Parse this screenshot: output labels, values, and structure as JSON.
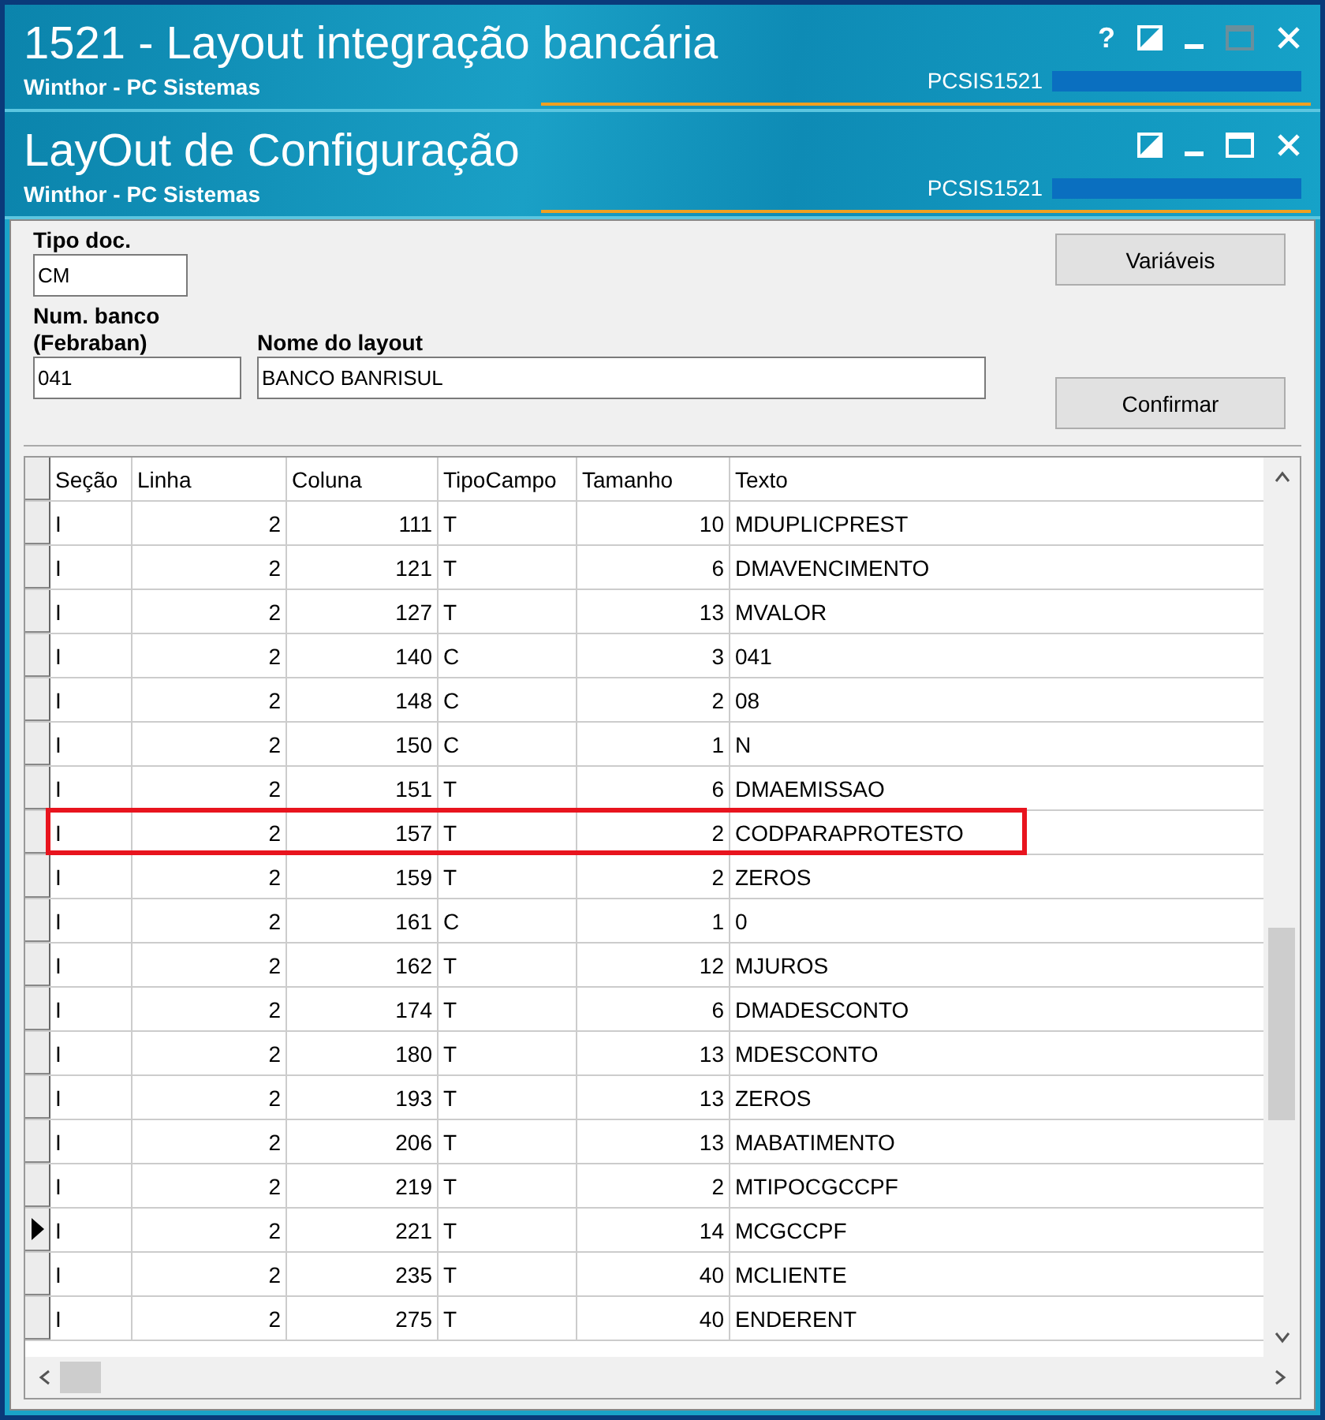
{
  "windows": [
    {
      "title": "1521 - Layout integração bancária",
      "subtitle": "Winthor - PC Sistemas",
      "code": "PCSIS1521",
      "controls": [
        {
          "kind": "help",
          "label": "?"
        },
        {
          "kind": "restore"
        },
        {
          "kind": "minimize"
        },
        {
          "kind": "maximize",
          "disabled": true
        },
        {
          "kind": "close"
        }
      ]
    },
    {
      "title": "LayOut de Configuração",
      "subtitle": "Winthor - PC Sistemas",
      "code": "PCSIS1521",
      "controls": [
        {
          "kind": "restore"
        },
        {
          "kind": "minimize"
        },
        {
          "kind": "maximize",
          "disabled": false
        },
        {
          "kind": "close"
        }
      ]
    }
  ],
  "form": {
    "tipo_doc": {
      "label": "Tipo doc.",
      "value": "CM"
    },
    "num_banco": {
      "label": "Num. banco\n(Febraban)",
      "value": "041"
    },
    "nome_layout": {
      "label": "Nome do layout",
      "value": "BANCO BANRISUL"
    },
    "buttons": [
      "Variáveis",
      "Confirmar"
    ]
  },
  "table": {
    "columns": [
      "Seção",
      "Linha",
      "Coluna",
      "TipoCampo",
      "Tamanho",
      "Texto"
    ],
    "rows": [
      {
        "cells": [
          "I",
          "2",
          "111",
          "T",
          "10",
          "MDUPLICPREST"
        ],
        "current": false,
        "highlighted": false
      },
      {
        "cells": [
          "I",
          "2",
          "121",
          "T",
          "6",
          "DMAVENCIMENTO"
        ],
        "current": false,
        "highlighted": false
      },
      {
        "cells": [
          "I",
          "2",
          "127",
          "T",
          "13",
          "MVALOR"
        ],
        "current": false,
        "highlighted": false
      },
      {
        "cells": [
          "I",
          "2",
          "140",
          "C",
          "3",
          "041"
        ],
        "current": false,
        "highlighted": false
      },
      {
        "cells": [
          "I",
          "2",
          "148",
          "C",
          "2",
          "08"
        ],
        "current": false,
        "highlighted": false
      },
      {
        "cells": [
          "I",
          "2",
          "150",
          "C",
          "1",
          "N"
        ],
        "current": false,
        "highlighted": false
      },
      {
        "cells": [
          "I",
          "2",
          "151",
          "T",
          "6",
          "DMAEMISSAO"
        ],
        "current": false,
        "highlighted": false
      },
      {
        "cells": [
          "I",
          "2",
          "157",
          "T",
          "2",
          "CODPARAPROTESTO"
        ],
        "current": false,
        "highlighted": true
      },
      {
        "cells": [
          "I",
          "2",
          "159",
          "T",
          "2",
          "ZEROS"
        ],
        "current": false,
        "highlighted": false
      },
      {
        "cells": [
          "I",
          "2",
          "161",
          "C",
          "1",
          "0"
        ],
        "current": false,
        "highlighted": false
      },
      {
        "cells": [
          "I",
          "2",
          "162",
          "T",
          "12",
          "MJUROS"
        ],
        "current": false,
        "highlighted": false
      },
      {
        "cells": [
          "I",
          "2",
          "174",
          "T",
          "6",
          "DMADESCONTO"
        ],
        "current": false,
        "highlighted": false
      },
      {
        "cells": [
          "I",
          "2",
          "180",
          "T",
          "13",
          "MDESCONTO"
        ],
        "current": false,
        "highlighted": false
      },
      {
        "cells": [
          "I",
          "2",
          "193",
          "T",
          "13",
          "ZEROS"
        ],
        "current": false,
        "highlighted": false
      },
      {
        "cells": [
          "I",
          "2",
          "206",
          "T",
          "13",
          "MABATIMENTO"
        ],
        "current": false,
        "highlighted": false
      },
      {
        "cells": [
          "I",
          "2",
          "219",
          "T",
          "2",
          "MTIPOCGCCPF"
        ],
        "current": false,
        "highlighted": false
      },
      {
        "cells": [
          "I",
          "2",
          "221",
          "T",
          "14",
          "MCGCCPF"
        ],
        "current": true,
        "highlighted": false
      },
      {
        "cells": [
          "I",
          "2",
          "235",
          "T",
          "40",
          "MCLIENTE"
        ],
        "current": false,
        "highlighted": false
      },
      {
        "cells": [
          "I",
          "2",
          "275",
          "T",
          "40",
          "ENDERENT"
        ],
        "current": false,
        "highlighted": false
      }
    ]
  }
}
